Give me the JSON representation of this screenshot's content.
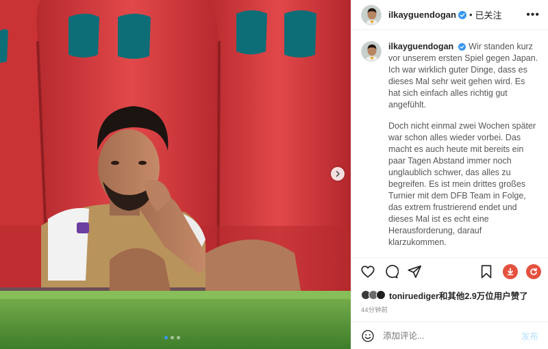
{
  "post": {
    "username": "ilkayguendogan",
    "follow_separator": "•",
    "follow_status": "已关注",
    "more_icon": "more-horizontal-icon",
    "caption_paragraphs": [
      "Wir standen kurz vor unserem ersten Spiel gegen Japan. Ich war wirklich guter Dinge, dass es dieses Mal sehr weit gehen wird. Es hat sich einfach alles richtig gut angefühlt.",
      "Doch nicht einmal zwei Wochen später war schon alles wieder vorbei. Das macht es auch heute mit bereits ein paar Tagen Abstand immer noch unglaublich schwer, das alles zu begreifen. Es ist mein drittes großes Turnier mit dem DFB Team in Folge, das extrem frustrierend endet und dieses Mal ist es echt eine Herausforderung, darauf klarzukommen."
    ],
    "likes_text": "toniruediger和其他2.9万位用户赞了",
    "timestamp": "44分钟前",
    "comment_placeholder": "添加评论...",
    "post_label": "发布"
  },
  "carousel": {
    "slide_count": 3,
    "active_index": 0
  },
  "colors": {
    "verified_blue": "#3897f0",
    "save_red": "#e5513f",
    "seat_red": "#d63b3b",
    "grass_green": "#5a9a3a"
  }
}
